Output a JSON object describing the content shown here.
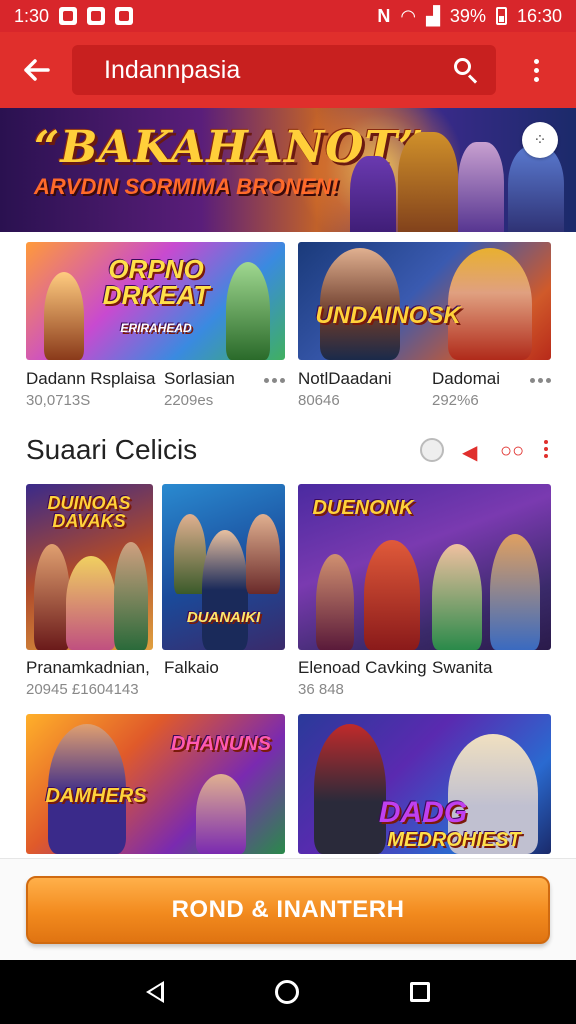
{
  "status_bar": {
    "time": "1:30",
    "battery": "39%",
    "clock": "16:30"
  },
  "app_bar": {
    "search_text": "Indannpasia"
  },
  "banner": {
    "title": "“BAKAHANOT”",
    "subtitle": "ARVDIN SORMIMA BRONEN!"
  },
  "top_cards": [
    {
      "art_text": "ORPNO DRKEAT",
      "art_sub": "ERIRAHEAD",
      "title": "Dadann Rsplaisa",
      "subtitle": "30,0713S"
    },
    {
      "art_text": "",
      "art_sub": "",
      "title": "Sorlasian",
      "subtitle": "2209es"
    },
    {
      "art_text": "UNDAINOSK",
      "art_sub": "",
      "title": "NotlDaadani",
      "subtitle": "80646"
    },
    {
      "art_text": "",
      "art_sub": "",
      "title": "Dadomai",
      "subtitle": "292%6"
    }
  ],
  "section": {
    "title": "Suaari Celicis"
  },
  "grid_cards": [
    {
      "art_text": "DUINOAS DAVAKS",
      "title": "Pranamkadnian,",
      "subtitle": "20945 £1604143"
    },
    {
      "art_text": "DUANAIKI",
      "title": "Falkaio",
      "subtitle": ""
    },
    {
      "art_text": "DUENONK",
      "title": "Elenoad Cavking",
      "subtitle": "36 848"
    },
    {
      "art_text": "",
      "title": "Swanita",
      "subtitle": ""
    }
  ],
  "bottom_cards": [
    {
      "art_text": "DAMHERS",
      "art_text_2": "DHANUNS"
    },
    {
      "art_text": "DADG",
      "art_text_2": "MEDROHIEST"
    }
  ],
  "cta": {
    "label": "ROND & INANTERH"
  },
  "colors": {
    "primary_red": "#e02f2c",
    "status_red": "#d8262b",
    "cta_orange": "#f28a1e"
  },
  "icons": {
    "back": "arrow-left-icon",
    "search": "search-icon",
    "more": "more-vertical-icon",
    "share": "share-icon"
  }
}
